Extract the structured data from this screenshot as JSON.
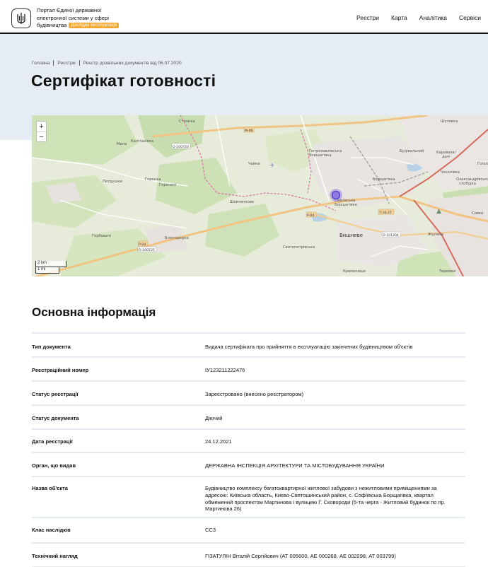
{
  "header": {
    "brand_line1": "Портал Єдиної державної",
    "brand_line2": "електронної системи у сфері",
    "brand_line3": "будівництва",
    "badge": "Дослідна експлуатація",
    "nav": [
      "Реєстри",
      "Карта",
      "Аналітика",
      "Сервіси"
    ]
  },
  "breadcrumbs": [
    "Головна",
    "Реєстри",
    "Реєстр дозвільних документів від 06.07.2020"
  ],
  "page_title": "Сертифікат готовності",
  "map": {
    "zoom_in": "+",
    "zoom_out": "−",
    "scale_km": "2 km",
    "scale_mi": "1 mi",
    "places": [
      "Стоянка",
      "Мила",
      "Капітанівка",
      "Петрушки",
      "Горенка",
      "Горбовичі",
      "Чайки",
      "Петропавлівська Борщагівка",
      "Софіївська Борщагівка",
      "Шевченкове",
      "Вишневе",
      "Святопетрівське",
      "Білогородка",
      "Гореничі",
      "Жуляни",
      "Кременище",
      "Борщагівка",
      "Шулявка",
      "Будівельний",
      "Караваєві дачі",
      "Чоколівка",
      "Олександрівська слобідка",
      "Совки",
      "Теремки",
      "Голосіїв"
    ],
    "roads": [
      "М-06",
      "О-100720",
      "Р-04",
      "Т-10-27",
      "О-101304",
      "Р-04 О-100725"
    ]
  },
  "info_title": "Основна інформація",
  "info_rows": [
    {
      "label": "Тип документа",
      "value": "Видача сертифіката про прийняття в експлуатацію закінчених будівництвом об'єктів"
    },
    {
      "label": "Реєстраційний номер",
      "value": "ІУ123211222476"
    },
    {
      "label": "Статус реєстрації",
      "value": "Зареєстровано (внесено реєстратором)"
    },
    {
      "label": "Статус документа",
      "value": "Діючий"
    },
    {
      "label": "Дата реєстрації",
      "value": "24.12.2021"
    },
    {
      "label": "Орган, що видав",
      "value": "ДЕРЖАВНА ІНСПЕКЦІЯ АРХІТЕКТУРИ ТА МІСТОБУДУВАННЯ УКРАЇНИ"
    },
    {
      "label": "Назва об'єкта",
      "value": "Будівництво комплексу багатоквартирної житлової забудови з нежитловими приміщеннями за адресою: Київська область, Києво-Святошинський район, с. Софіївська Борщагівка, квартал обмежений проспектом Мартинова і вулицею Г. Сковороди (5-та черга - Житловий будинок по пр. Мартинова 26)"
    },
    {
      "label": "Клас наслідків",
      "value": "СС3"
    },
    {
      "label": "Технічний нагляд",
      "value": "ГІЗАТУЛІН Віталій Сергійович (АТ 005600, АЕ 000268, АЕ 002298, АТ 003799)"
    }
  ]
}
